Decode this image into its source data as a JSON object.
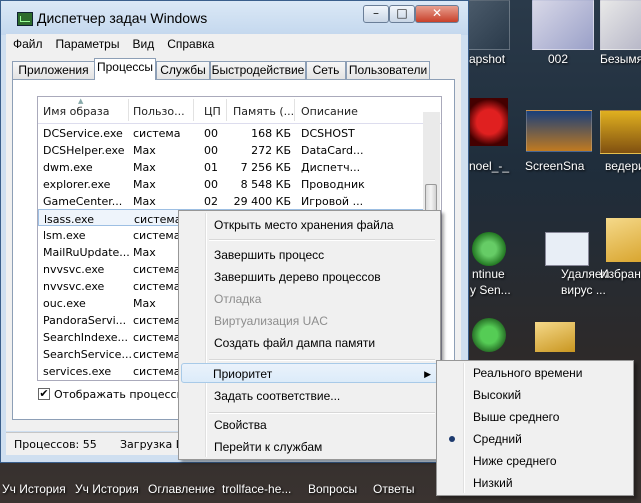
{
  "window": {
    "title": "Диспетчер задач Windows",
    "minimize": "–",
    "maximize": "□",
    "close": "✕"
  },
  "menubar": [
    "Файл",
    "Параметры",
    "Вид",
    "Справка"
  ],
  "tabs": [
    "Приложения",
    "Процессы",
    "Службы",
    "Быстродействие",
    "Сеть",
    "Пользователи"
  ],
  "active_tab": "Процессы",
  "table": {
    "headers": [
      "Имя образа",
      "Пользо...",
      "ЦП",
      "Память (...",
      "Описание"
    ],
    "rows": [
      [
        "DCService.exe",
        "система",
        "00",
        "168 КБ",
        "DCSHOST"
      ],
      [
        "DCSHelper.exe",
        "Max",
        "00",
        "272 КБ",
        "DataCard..."
      ],
      [
        "dwm.exe",
        "Max",
        "01",
        "7 256 КБ",
        "Диспетч..."
      ],
      [
        "explorer.exe",
        "Max",
        "00",
        "8 548 КБ",
        "Проводник"
      ],
      [
        "GameCenter...",
        "Max",
        "02",
        "29 400 КБ",
        "Игровой ..."
      ],
      [
        "lsass.exe",
        "система",
        "",
        "",
        ""
      ],
      [
        "lsm.exe",
        "система",
        "",
        "",
        ""
      ],
      [
        "MailRuUpdate...",
        "Max",
        "",
        "",
        ""
      ],
      [
        "nvvsvc.exe",
        "система",
        "",
        "",
        ""
      ],
      [
        "nvvsvc.exe",
        "система",
        "",
        "",
        ""
      ],
      [
        "ouc.exe",
        "Max",
        "",
        "",
        ""
      ],
      [
        "PandoraServi...",
        "система",
        "",
        "",
        ""
      ],
      [
        "SearchIndexe...",
        "система",
        "",
        "",
        ""
      ],
      [
        "SearchService...",
        "система",
        "",
        "",
        ""
      ],
      [
        "services.exe",
        "система",
        "",
        "",
        ""
      ]
    ]
  },
  "checkbox": {
    "label": "Отображать процессы в",
    "checked": "✔"
  },
  "status": {
    "processes": "Процессов: 55",
    "load": "Загрузка L"
  },
  "context_menu": [
    "Открыть место хранения файла",
    "Завершить процесс",
    "Завершить дерево процессов",
    "Отладка",
    "Виртуализация UAC",
    "Создать файл дампа памяти",
    "Приоритет",
    "Задать соответствие...",
    "Свойства",
    "Перейти к службам"
  ],
  "priority_menu": [
    "Реального времени",
    "Высокий",
    "Выше среднего",
    "Средний",
    "Ниже среднего",
    "Низкий"
  ],
  "selected_priority": "Средний",
  "submenu_arrow": "▶",
  "radio_mark": "●",
  "desktop": {
    "labels": [
      "apshot",
      "002",
      "Безымя",
      "noel_-_",
      "ScreenSna",
      "ведери",
      "ntinue",
      "y Sen...",
      "Удаляем",
      "вирус ...",
      "Избран"
    ],
    "bottom_labels": [
      "Уч История",
      "Уч История",
      "Оглавление",
      "trollface-he...",
      "Вопросы",
      "Ответы"
    ]
  },
  "colors": {
    "accent": "#3399ff",
    "window_frame": "#c4d8ee",
    "selection": "#dcebf9"
  }
}
